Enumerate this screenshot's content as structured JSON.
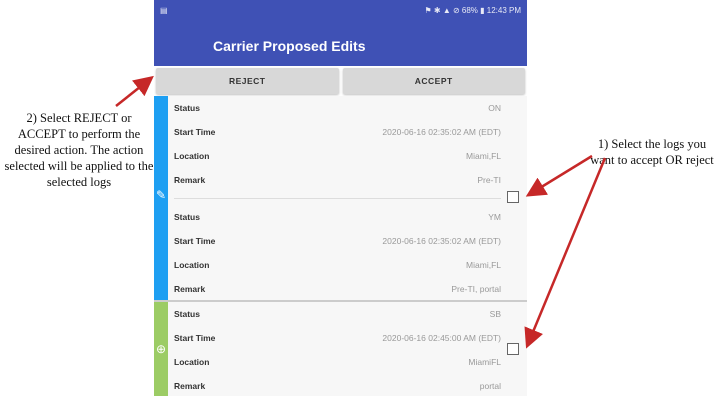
{
  "colors": {
    "header": "#3f51b5",
    "group1_accent": "#1e9ff2",
    "group2_accent": "#9ccc65"
  },
  "status_bar": {
    "left_icon": "clipboard-icon",
    "indicators": "⚑ ✱ ▲ ⊘ 68% ▮ 12:43 PM"
  },
  "header": {
    "title": "Carrier Proposed Edits"
  },
  "actions": {
    "reject_label": "REJECT",
    "accept_label": "ACCEPT"
  },
  "labels": {
    "status": "Status",
    "start_time": "Start Time",
    "location": "Location",
    "remark": "Remark"
  },
  "groups": [
    {
      "icon": "pencil-icon",
      "records": [
        {
          "status": "ON",
          "start_time": "2020-06-16 02:35:02 AM (EDT)",
          "location": "Miami,FL",
          "remark": "Pre-TI"
        },
        {
          "status": "YM",
          "start_time": "2020-06-16 02:35:02 AM (EDT)",
          "location": "Miami,FL",
          "remark": "Pre-TI, portal"
        }
      ]
    },
    {
      "icon": "add-circle-icon",
      "records": [
        {
          "status": "SB",
          "start_time": "2020-06-16 02:45:00 AM (EDT)",
          "location": "MiamiFL",
          "remark": "portal"
        }
      ]
    }
  ],
  "annotations": {
    "left": "2) Select REJECT or ACCEPT to perform the desired action. The action selected will be applied to the selected logs",
    "right": "1) Select the logs you want to accept OR reject"
  }
}
